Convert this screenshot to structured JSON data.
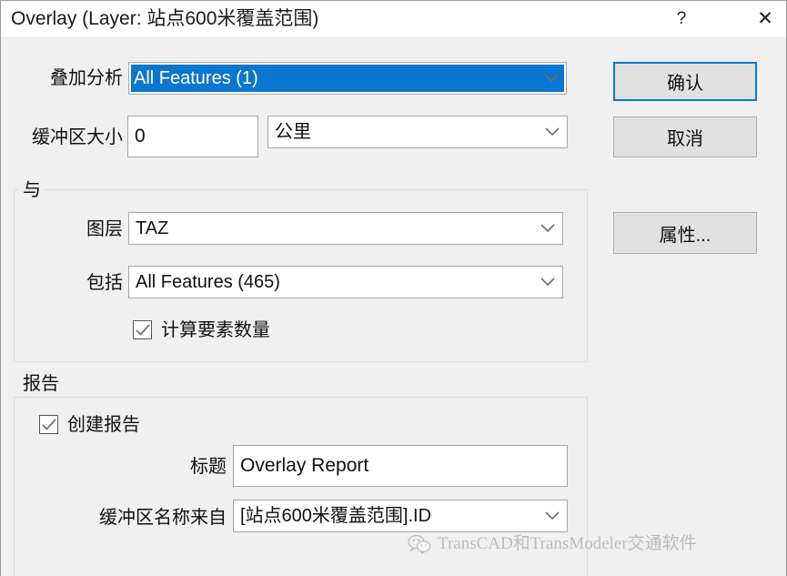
{
  "window": {
    "title": "Overlay (Layer: 站点600米覆盖范围)",
    "help_label": "?",
    "close_label": "✕"
  },
  "form": {
    "overlay_label": "叠加分析",
    "overlay_value": "All Features (1)",
    "buffer_size_label": "缓冲区大小",
    "buffer_size_value": "0",
    "buffer_unit_value": "公里"
  },
  "with_group": {
    "title": "与",
    "layer_label": "图层",
    "layer_value": "TAZ",
    "include_label": "包括",
    "include_value": "All Features (465)",
    "count_features_label": "计算要素数量",
    "count_features_checked": true
  },
  "report_group": {
    "title": "报告",
    "create_report_label": "创建报告",
    "create_report_checked": true,
    "title_label": "标题",
    "title_value": "Overlay Report",
    "buffer_name_label": "缓冲区名称来自",
    "buffer_name_value": "[站点600米覆盖范围].ID"
  },
  "buttons": {
    "ok_label": "确认",
    "cancel_label": "取消",
    "attributes_label": "属性..."
  },
  "watermark": {
    "text": "TransCAD和TransModeler交通软件"
  },
  "colors": {
    "accent": "#0a76d0",
    "dialog_background": "#f0f0f0",
    "titlebar_background": "#ffffff",
    "button_face": "#e1e1e1"
  }
}
